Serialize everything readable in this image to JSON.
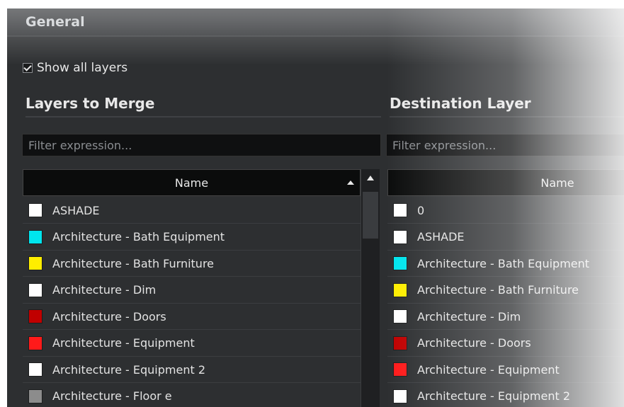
{
  "section": {
    "title": "General"
  },
  "show_all": {
    "label": "Show all layers",
    "checked": true
  },
  "left": {
    "title": "Layers to Merge",
    "filter_placeholder": "Filter expression...",
    "column_header": "Name",
    "rows": [
      {
        "name": "ASHADE",
        "color": "#ffffff"
      },
      {
        "name": "Architecture - Bath Equipment",
        "color": "#00e5ee"
      },
      {
        "name": "Architecture - Bath Furniture",
        "color": "#ffee00"
      },
      {
        "name": "Architecture - Dim",
        "color": "#ffffff"
      },
      {
        "name": "Architecture - Doors",
        "color": "#c00000"
      },
      {
        "name": "Architecture - Equipment",
        "color": "#ff1a1a"
      },
      {
        "name": "Architecture - Equipment 2",
        "color": "#ffffff"
      },
      {
        "name": "Architecture - Floor e",
        "color": "#8c8c8c"
      }
    ]
  },
  "right": {
    "title": "Destination Layer",
    "filter_placeholder": "Filter expression...",
    "column_header": "Name",
    "rows": [
      {
        "name": "0",
        "color": "#ffffff"
      },
      {
        "name": "ASHADE",
        "color": "#ffffff"
      },
      {
        "name": "Architecture - Bath Equipment",
        "color": "#00e5ee"
      },
      {
        "name": "Architecture - Bath Furniture",
        "color": "#ffee00"
      },
      {
        "name": "Architecture - Dim",
        "color": "#ffffff"
      },
      {
        "name": "Architecture - Doors",
        "color": "#c00000"
      },
      {
        "name": "Architecture - Equipment",
        "color": "#ff1a1a"
      },
      {
        "name": "Architecture - Equipment 2",
        "color": "#ffffff"
      }
    ]
  }
}
